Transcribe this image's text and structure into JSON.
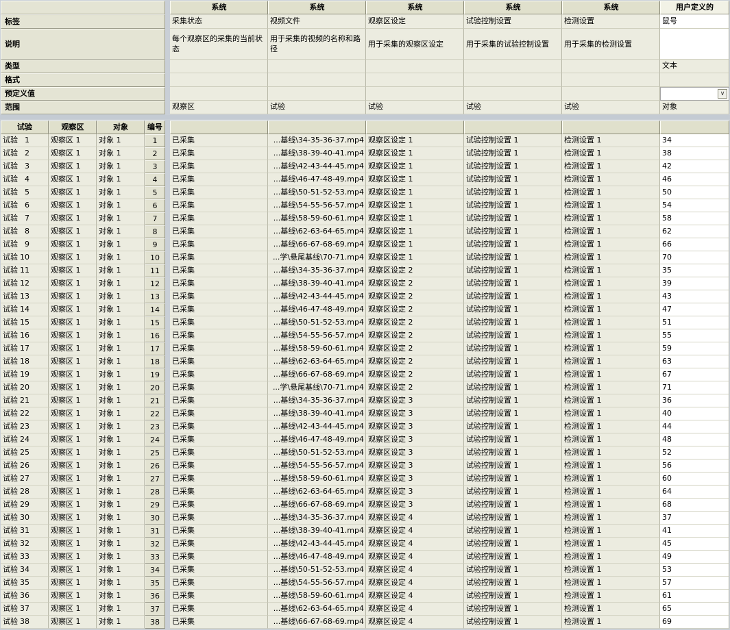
{
  "header": {
    "row_labels": [
      "标签",
      "说明",
      "类型",
      "格式",
      "预定义值",
      "范围"
    ],
    "columns": [
      {
        "group": "系统",
        "tag": "采集状态",
        "description": "每个观察区的采集的当前状态",
        "type": "",
        "format": "",
        "range": "观察区"
      },
      {
        "group": "系统",
        "tag": "视频文件",
        "description": "用于采集的视频的名称和路径",
        "type": "",
        "format": "",
        "range": "试验"
      },
      {
        "group": "系统",
        "tag": "观察区设定",
        "description": "用于采集的观察区设定",
        "type": "",
        "format": "",
        "range": "试验"
      },
      {
        "group": "系统",
        "tag": "试验控制设置",
        "description": "用于采集的试验控制设置",
        "type": "",
        "format": "",
        "range": "试验"
      },
      {
        "group": "系统",
        "tag": "检测设置",
        "description": "用于采集的检测设置",
        "type": "",
        "format": "",
        "range": "试验"
      },
      {
        "group": "用户定义的",
        "tag": "鼠号",
        "description": "",
        "type": "文本",
        "format": "",
        "range": "对象"
      }
    ],
    "predefined_select_value": ""
  },
  "table": {
    "left_headers": [
      "试验",
      "观察区",
      "对象",
      "编号"
    ],
    "rows": [
      [
        "试验",
        "1",
        "观察区 1",
        "对象 1",
        "1",
        "已采集",
        "...基线\\34-35-36-37.mp4",
        "观察区设定 1",
        "试验控制设置 1",
        "检测设置 1",
        "34"
      ],
      [
        "试验",
        "2",
        "观察区 1",
        "对象 1",
        "2",
        "已采集",
        "...基线\\38-39-40-41.mp4",
        "观察区设定 1",
        "试验控制设置 1",
        "检测设置 1",
        "38"
      ],
      [
        "试验",
        "3",
        "观察区 1",
        "对象 1",
        "3",
        "已采集",
        "...基线\\42-43-44-45.mp4",
        "观察区设定 1",
        "试验控制设置 1",
        "检测设置 1",
        "42"
      ],
      [
        "试验",
        "4",
        "观察区 1",
        "对象 1",
        "4",
        "已采集",
        "...基线\\46-47-48-49.mp4",
        "观察区设定 1",
        "试验控制设置 1",
        "检测设置 1",
        "46"
      ],
      [
        "试验",
        "5",
        "观察区 1",
        "对象 1",
        "5",
        "已采集",
        "...基线\\50-51-52-53.mp4",
        "观察区设定 1",
        "试验控制设置 1",
        "检测设置 1",
        "50"
      ],
      [
        "试验",
        "6",
        "观察区 1",
        "对象 1",
        "6",
        "已采集",
        "...基线\\54-55-56-57.mp4",
        "观察区设定 1",
        "试验控制设置 1",
        "检测设置 1",
        "54"
      ],
      [
        "试验",
        "7",
        "观察区 1",
        "对象 1",
        "7",
        "已采集",
        "...基线\\58-59-60-61.mp4",
        "观察区设定 1",
        "试验控制设置 1",
        "检测设置 1",
        "58"
      ],
      [
        "试验",
        "8",
        "观察区 1",
        "对象 1",
        "8",
        "已采集",
        "...基线\\62-63-64-65.mp4",
        "观察区设定 1",
        "试验控制设置 1",
        "检测设置 1",
        "62"
      ],
      [
        "试验",
        "9",
        "观察区 1",
        "对象 1",
        "9",
        "已采集",
        "...基线\\66-67-68-69.mp4",
        "观察区设定 1",
        "试验控制设置 1",
        "检测设置 1",
        "66"
      ],
      [
        "试验",
        "10",
        "观察区 1",
        "对象 1",
        "10",
        "已采集",
        "...学\\悬尾基线\\70-71.mp4",
        "观察区设定 1",
        "试验控制设置 1",
        "检测设置 1",
        "70"
      ],
      [
        "试验",
        "11",
        "观察区 1",
        "对象 1",
        "11",
        "已采集",
        "...基线\\34-35-36-37.mp4",
        "观察区设定 2",
        "试验控制设置 1",
        "检测设置 1",
        "35"
      ],
      [
        "试验",
        "12",
        "观察区 1",
        "对象 1",
        "12",
        "已采集",
        "...基线\\38-39-40-41.mp4",
        "观察区设定 2",
        "试验控制设置 1",
        "检测设置 1",
        "39"
      ],
      [
        "试验",
        "13",
        "观察区 1",
        "对象 1",
        "13",
        "已采集",
        "...基线\\42-43-44-45.mp4",
        "观察区设定 2",
        "试验控制设置 1",
        "检测设置 1",
        "43"
      ],
      [
        "试验",
        "14",
        "观察区 1",
        "对象 1",
        "14",
        "已采集",
        "...基线\\46-47-48-49.mp4",
        "观察区设定 2",
        "试验控制设置 1",
        "检测设置 1",
        "47"
      ],
      [
        "试验",
        "15",
        "观察区 1",
        "对象 1",
        "15",
        "已采集",
        "...基线\\50-51-52-53.mp4",
        "观察区设定 2",
        "试验控制设置 1",
        "检测设置 1",
        "51"
      ],
      [
        "试验",
        "16",
        "观察区 1",
        "对象 1",
        "16",
        "已采集",
        "...基线\\54-55-56-57.mp4",
        "观察区设定 2",
        "试验控制设置 1",
        "检测设置 1",
        "55"
      ],
      [
        "试验",
        "17",
        "观察区 1",
        "对象 1",
        "17",
        "已采集",
        "...基线\\58-59-60-61.mp4",
        "观察区设定 2",
        "试验控制设置 1",
        "检测设置 1",
        "59"
      ],
      [
        "试验",
        "18",
        "观察区 1",
        "对象 1",
        "18",
        "已采集",
        "...基线\\62-63-64-65.mp4",
        "观察区设定 2",
        "试验控制设置 1",
        "检测设置 1",
        "63"
      ],
      [
        "试验",
        "19",
        "观察区 1",
        "对象 1",
        "19",
        "已采集",
        "...基线\\66-67-68-69.mp4",
        "观察区设定 2",
        "试验控制设置 1",
        "检测设置 1",
        "67"
      ],
      [
        "试验",
        "20",
        "观察区 1",
        "对象 1",
        "20",
        "已采集",
        "...学\\悬尾基线\\70-71.mp4",
        "观察区设定 2",
        "试验控制设置 1",
        "检测设置 1",
        "71"
      ],
      [
        "试验",
        "21",
        "观察区 1",
        "对象 1",
        "21",
        "已采集",
        "...基线\\34-35-36-37.mp4",
        "观察区设定 3",
        "试验控制设置 1",
        "检测设置 1",
        "36"
      ],
      [
        "试验",
        "22",
        "观察区 1",
        "对象 1",
        "22",
        "已采集",
        "...基线\\38-39-40-41.mp4",
        "观察区设定 3",
        "试验控制设置 1",
        "检测设置 1",
        "40"
      ],
      [
        "试验",
        "23",
        "观察区 1",
        "对象 1",
        "23",
        "已采集",
        "...基线\\42-43-44-45.mp4",
        "观察区设定 3",
        "试验控制设置 1",
        "检测设置 1",
        "44"
      ],
      [
        "试验",
        "24",
        "观察区 1",
        "对象 1",
        "24",
        "已采集",
        "...基线\\46-47-48-49.mp4",
        "观察区设定 3",
        "试验控制设置 1",
        "检测设置 1",
        "48"
      ],
      [
        "试验",
        "25",
        "观察区 1",
        "对象 1",
        "25",
        "已采集",
        "...基线\\50-51-52-53.mp4",
        "观察区设定 3",
        "试验控制设置 1",
        "检测设置 1",
        "52"
      ],
      [
        "试验",
        "26",
        "观察区 1",
        "对象 1",
        "26",
        "已采集",
        "...基线\\54-55-56-57.mp4",
        "观察区设定 3",
        "试验控制设置 1",
        "检测设置 1",
        "56"
      ],
      [
        "试验",
        "27",
        "观察区 1",
        "对象 1",
        "27",
        "已采集",
        "...基线\\58-59-60-61.mp4",
        "观察区设定 3",
        "试验控制设置 1",
        "检测设置 1",
        "60"
      ],
      [
        "试验",
        "28",
        "观察区 1",
        "对象 1",
        "28",
        "已采集",
        "...基线\\62-63-64-65.mp4",
        "观察区设定 3",
        "试验控制设置 1",
        "检测设置 1",
        "64"
      ],
      [
        "试验",
        "29",
        "观察区 1",
        "对象 1",
        "29",
        "已采集",
        "...基线\\66-67-68-69.mp4",
        "观察区设定 3",
        "试验控制设置 1",
        "检测设置 1",
        "68"
      ],
      [
        "试验",
        "30",
        "观察区 1",
        "对象 1",
        "30",
        "已采集",
        "...基线\\34-35-36-37.mp4",
        "观察区设定 4",
        "试验控制设置 1",
        "检测设置 1",
        "37"
      ],
      [
        "试验",
        "31",
        "观察区 1",
        "对象 1",
        "31",
        "已采集",
        "...基线\\38-39-40-41.mp4",
        "观察区设定 4",
        "试验控制设置 1",
        "检测设置 1",
        "41"
      ],
      [
        "试验",
        "32",
        "观察区 1",
        "对象 1",
        "32",
        "已采集",
        "...基线\\42-43-44-45.mp4",
        "观察区设定 4",
        "试验控制设置 1",
        "检测设置 1",
        "45"
      ],
      [
        "试验",
        "33",
        "观察区 1",
        "对象 1",
        "33",
        "已采集",
        "...基线\\46-47-48-49.mp4",
        "观察区设定 4",
        "试验控制设置 1",
        "检测设置 1",
        "49"
      ],
      [
        "试验",
        "34",
        "观察区 1",
        "对象 1",
        "34",
        "已采集",
        "...基线\\50-51-52-53.mp4",
        "观察区设定 4",
        "试验控制设置 1",
        "检测设置 1",
        "53"
      ],
      [
        "试验",
        "35",
        "观察区 1",
        "对象 1",
        "35",
        "已采集",
        "...基线\\54-55-56-57.mp4",
        "观察区设定 4",
        "试验控制设置 1",
        "检测设置 1",
        "57"
      ],
      [
        "试验",
        "36",
        "观察区 1",
        "对象 1",
        "36",
        "已采集",
        "...基线\\58-59-60-61.mp4",
        "观察区设定 4",
        "试验控制设置 1",
        "检测设置 1",
        "61"
      ],
      [
        "试验",
        "37",
        "观察区 1",
        "对象 1",
        "37",
        "已采集",
        "...基线\\62-63-64-65.mp4",
        "观察区设定 4",
        "试验控制设置 1",
        "检测设置 1",
        "65"
      ],
      [
        "试验",
        "38",
        "观察区 1",
        "对象 1",
        "38",
        "已采集",
        "...基线\\66-67-68-69.mp4",
        "观察区设定 4",
        "试验控制设置 1",
        "检测设置 1",
        "69"
      ]
    ]
  }
}
